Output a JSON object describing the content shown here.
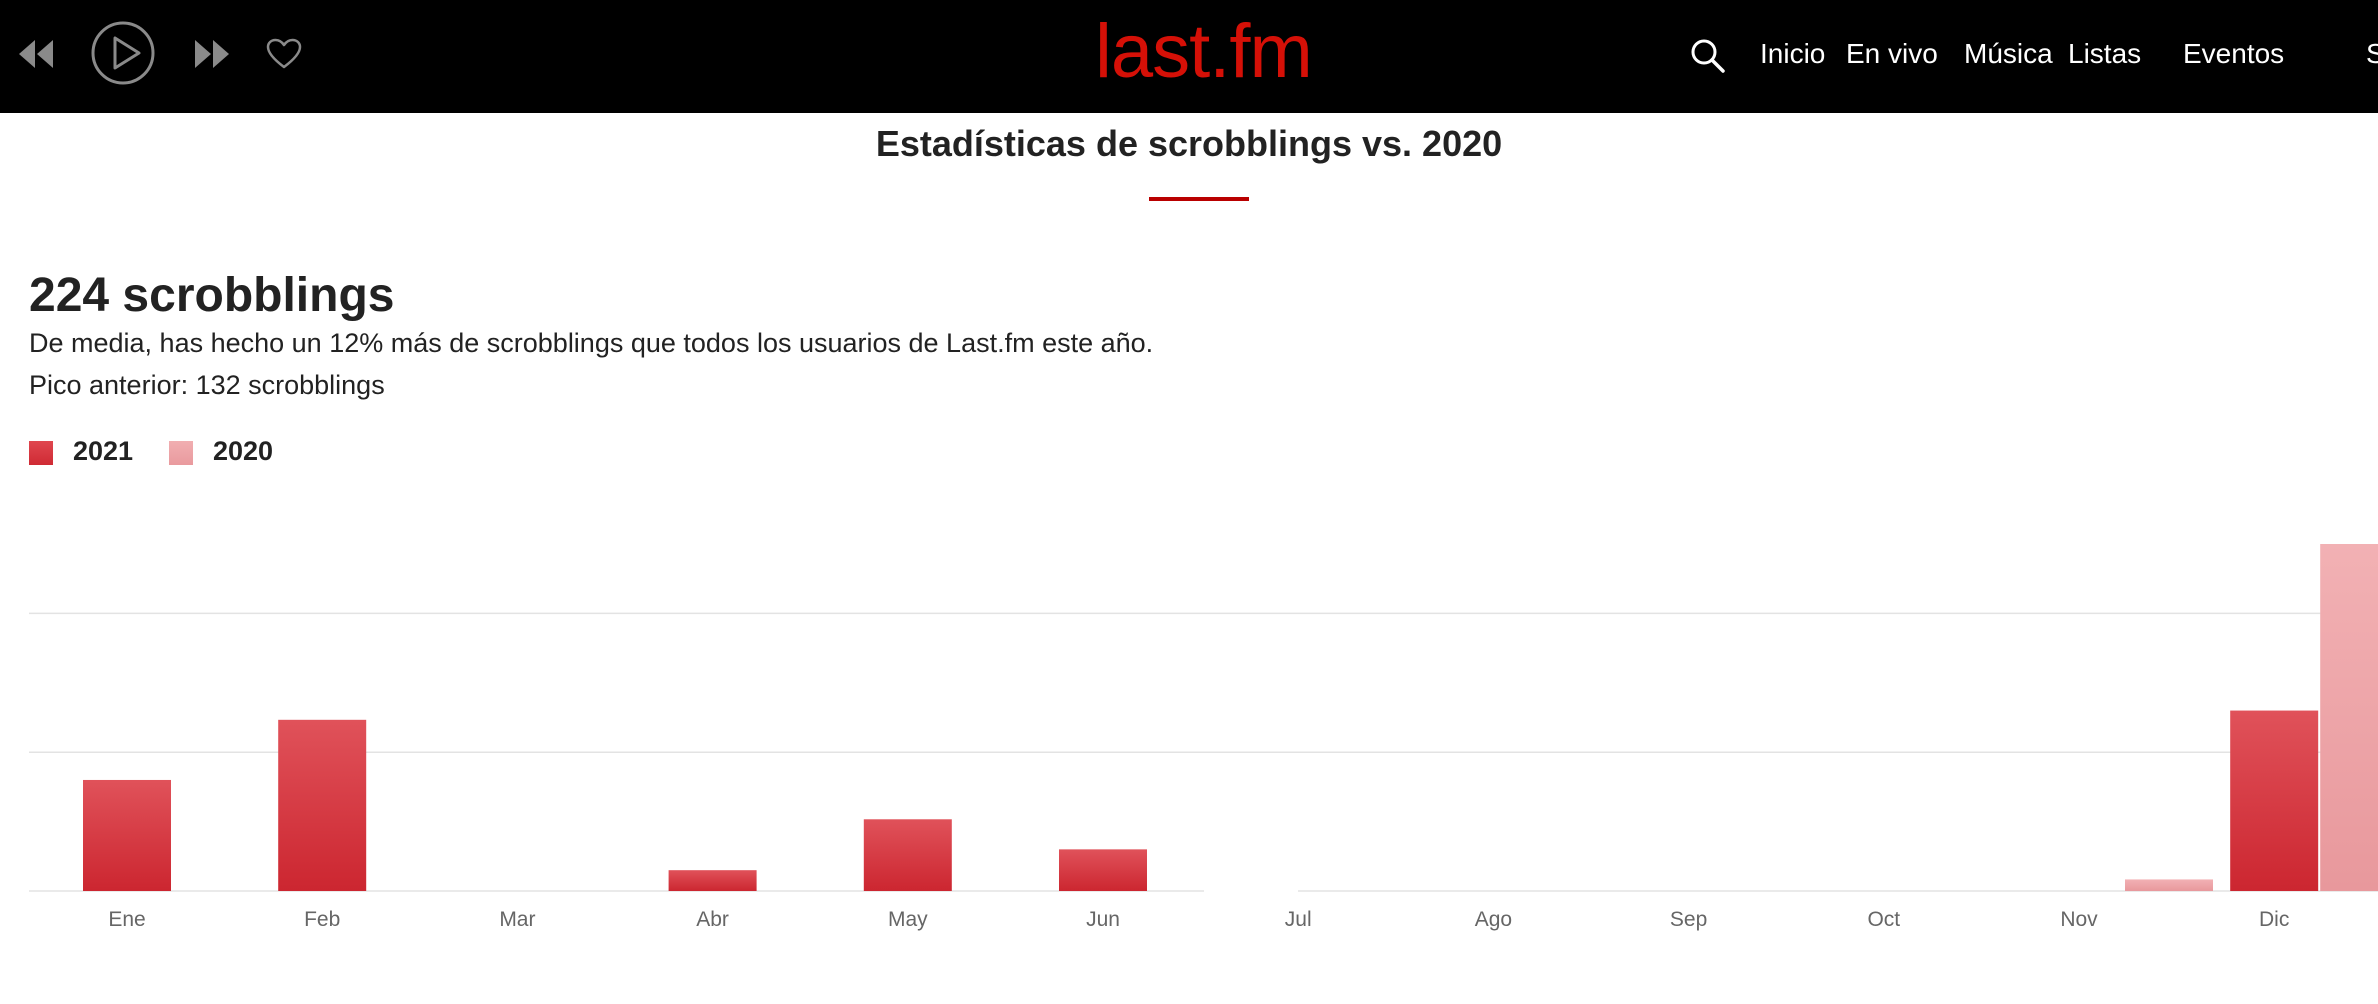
{
  "player": {
    "controls": [
      {
        "name": "rewind",
        "icon": "rewind-icon"
      },
      {
        "name": "play",
        "icon": "play-icon"
      },
      {
        "name": "fast-forward",
        "icon": "fast-forward-icon"
      },
      {
        "name": "love",
        "icon": "heart-icon"
      }
    ]
  },
  "header": {
    "logo": "last.fm",
    "search_icon": "search-icon",
    "nav": [
      "Inicio",
      "En vivo",
      "Música",
      "Listas",
      "Eventos",
      "S"
    ]
  },
  "section": {
    "title": "Estadísticas de scrobblings vs. 2020"
  },
  "summary": {
    "total": "224 scrobblings",
    "comparison": "De media, has hecho un 12% más de scrobblings que todos los usuarios de Last.fm este año.",
    "previous_peak": "Pico anterior: 132 scrobblings"
  },
  "colors": {
    "brand": "#d51007",
    "accent_rule": "#b90000",
    "series_2021": "#d9303a",
    "series_2020": "#eea3a6",
    "gridline": "#e3e3e3",
    "axis_text": "#666666"
  },
  "chart_data": {
    "type": "bar",
    "categories": [
      "Ene",
      "Feb",
      "Mar",
      "Abr",
      "May",
      "Jun",
      "Jul",
      "Ago",
      "Sep",
      "Oct",
      "Nov",
      "Dic"
    ],
    "series": [
      {
        "name": "2021",
        "values": [
          48,
          74,
          0,
          9,
          31,
          18,
          0,
          0,
          0,
          0,
          0,
          78
        ]
      },
      {
        "name": "2020",
        "values": [
          0,
          0,
          0,
          0,
          0,
          0,
          0,
          0,
          0,
          0,
          5,
          150
        ]
      }
    ],
    "ylim": [
      0,
      150
    ],
    "gridlines": [
      60,
      120
    ],
    "grid": true,
    "legend": "top-left",
    "title": "",
    "xlabel": "",
    "ylabel": ""
  }
}
